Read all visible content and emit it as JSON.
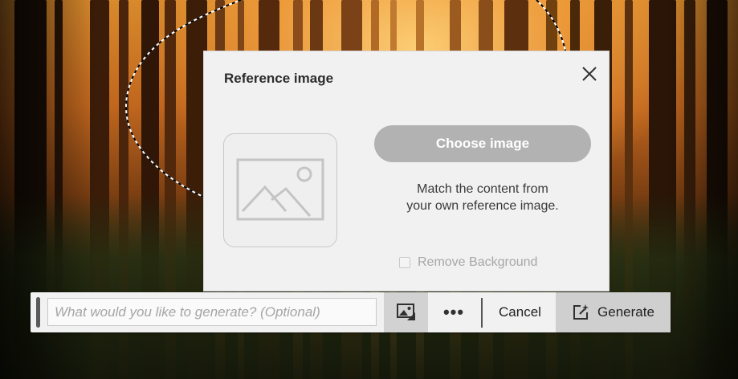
{
  "panel": {
    "title": "Reference image",
    "choose_image_label": "Choose image",
    "description_line1": "Match the content from",
    "description_line2": "your own reference image.",
    "remove_background_label": "Remove Background",
    "remove_background_checked": false
  },
  "toolbar": {
    "prompt_placeholder": "What would you like to generate? (Optional)",
    "prompt_value": "",
    "more_label": "•••",
    "cancel_label": "Cancel",
    "generate_label": "Generate"
  },
  "icons": {
    "close": "close-icon",
    "placeholder_image": "image-placeholder-icon",
    "reference_image": "reference-image-icon",
    "generate": "generate-sparkle-icon"
  },
  "colors": {
    "panel_bg": "#f1f1f1",
    "choose_button_bg": "#b2b2b2",
    "generate_button_bg": "#cfcfcf",
    "active_tool_bg": "#d2d2d2"
  }
}
